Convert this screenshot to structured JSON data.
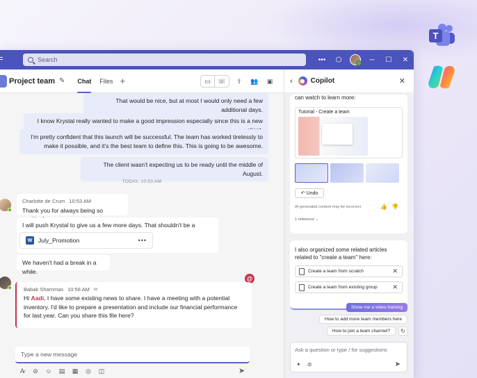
{
  "titlebar": {
    "search_placeholder": "Search"
  },
  "chat": {
    "title": "Project team",
    "tabs": [
      {
        "label": "Chat",
        "active": true
      },
      {
        "label": "Files",
        "active": false
      }
    ]
  },
  "messages": {
    "mine": [
      "That would be nice, but at most I would only need a few additional days.",
      "I know Krystal really wanted to make a good impression especially since this is a new client.",
      "I'm pretty confident that this launch will be successful. The team has worked tirelessly to make it possible, and it's the best team to define this. This is going to be awesome.",
      "The client wasn't expecting us to be ready until the middle of August."
    ],
    "day_separator": "TODAY, 10:53 AM",
    "charlotte": {
      "name": "Charlotte de Crum",
      "time": "10:53 AM",
      "messages": [
        "Thank you for always being so positive!",
        "I will push Krystal to give us a few more days. That shouldn't be a problem.",
        "We haven't had a break in a while."
      ],
      "file_name": "July_Promotion",
      "file_icon_letter": "W"
    },
    "babak": {
      "name": "Babak Shammas",
      "time": "10:58 AM",
      "greeting": "Hi ",
      "mention": "Aadi",
      "text": ", I have some existing news to share. I have a meeting with a potential inventory. I'd like to prepare a presentation and include our financial performance for last year. Can you share this file here?"
    }
  },
  "compose": {
    "placeholder": "Type a new message"
  },
  "copilot": {
    "title": "Copilot",
    "intro_partial": "can watch to learn more:",
    "tutorial_title": "Tutorial - Create a team",
    "undo_label": "Undo",
    "ai_note": "AI-generated content may be incorrect",
    "reference_label": "1 reference",
    "related_intro": "I also organized some related articles related to \"create a team\" here:",
    "related_items": [
      "Create a team from scratch",
      "Create a team from existing group"
    ],
    "suggestions": [
      "Show me a video training",
      "How to add more team members here",
      "How to join a team channel?"
    ],
    "ask_placeholder": "Ask a question or type / for suggestions"
  },
  "colors": {
    "titlebar": "#4b53bc",
    "accent": "#5b5fc7",
    "mention": "#c4314b"
  }
}
